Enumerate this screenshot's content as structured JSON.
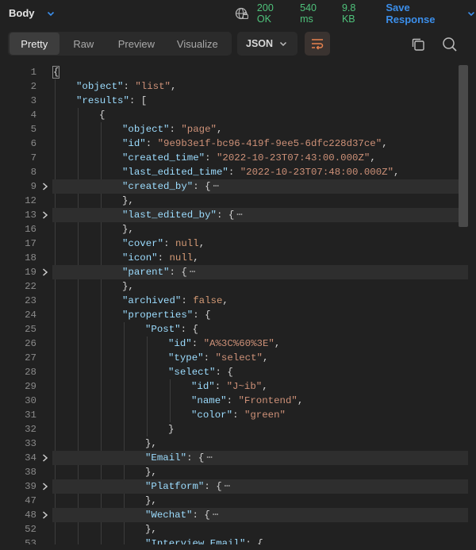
{
  "header": {
    "body_label": "Body",
    "status_code": "200 OK",
    "time": "540 ms",
    "size": "9.8 KB",
    "save_label": "Save Response"
  },
  "toolbar": {
    "tabs": [
      "Pretty",
      "Raw",
      "Preview",
      "Visualize"
    ],
    "active_tab": "Pretty",
    "format": "JSON",
    "icons": [
      "globe-icon",
      "chevron-down-icon",
      "wrap-lines-icon",
      "copy-icon",
      "search-icon"
    ]
  },
  "colors": {
    "key": "#9cdcfe",
    "string": "#ce9178",
    "keyword": "#d49a75",
    "status_green": "#4fc27b",
    "accent_blue": "#3b8eea",
    "wrap_icon": "#e8824e"
  },
  "code": {
    "lines": [
      {
        "n": "1",
        "indent": 0,
        "tokens": [
          [
            "p",
            "{"
          ]
        ],
        "box": true
      },
      {
        "n": "2",
        "indent": 1,
        "tokens": [
          [
            "k",
            "\"object\""
          ],
          [
            "p",
            ": "
          ],
          [
            "s",
            "\"list\""
          ],
          [
            "p",
            ","
          ]
        ]
      },
      {
        "n": "3",
        "indent": 1,
        "tokens": [
          [
            "k",
            "\"results\""
          ],
          [
            "p",
            ": ["
          ]
        ]
      },
      {
        "n": "4",
        "indent": 2,
        "tokens": [
          [
            "p",
            "{"
          ]
        ]
      },
      {
        "n": "5",
        "indent": 3,
        "tokens": [
          [
            "k",
            "\"object\""
          ],
          [
            "p",
            ": "
          ],
          [
            "s",
            "\"page\""
          ],
          [
            "p",
            ","
          ]
        ]
      },
      {
        "n": "6",
        "indent": 3,
        "tokens": [
          [
            "k",
            "\"id\""
          ],
          [
            "p",
            ": "
          ],
          [
            "s",
            "\"9e9b3e1f-bc96-419f-9ee5-6dfc228d37ce\""
          ],
          [
            "p",
            ","
          ]
        ]
      },
      {
        "n": "7",
        "indent": 3,
        "tokens": [
          [
            "k",
            "\"created_time\""
          ],
          [
            "p",
            ": "
          ],
          [
            "s",
            "\"2022-10-23T07:43:00.000Z\""
          ],
          [
            "p",
            ","
          ]
        ]
      },
      {
        "n": "8",
        "indent": 3,
        "tokens": [
          [
            "k",
            "\"last_edited_time\""
          ],
          [
            "p",
            ": "
          ],
          [
            "s",
            "\"2022-10-23T07:48:00.000Z\""
          ],
          [
            "p",
            ","
          ]
        ]
      },
      {
        "n": "9",
        "indent": 3,
        "tokens": [
          [
            "k",
            "\"created_by\""
          ],
          [
            "p",
            ": {"
          ],
          [
            "e",
            "⋯"
          ]
        ],
        "fold": true,
        "hl": true
      },
      {
        "n": "12",
        "indent": 3,
        "tokens": [
          [
            "p",
            "},"
          ]
        ]
      },
      {
        "n": "13",
        "indent": 3,
        "tokens": [
          [
            "k",
            "\"last_edited_by\""
          ],
          [
            "p",
            ": {"
          ],
          [
            "e",
            "⋯"
          ]
        ],
        "fold": true,
        "hl": true
      },
      {
        "n": "16",
        "indent": 3,
        "tokens": [
          [
            "p",
            "},"
          ]
        ]
      },
      {
        "n": "17",
        "indent": 3,
        "tokens": [
          [
            "k",
            "\"cover\""
          ],
          [
            "p",
            ": "
          ],
          [
            "w",
            "null"
          ],
          [
            "p",
            ","
          ]
        ]
      },
      {
        "n": "18",
        "indent": 3,
        "tokens": [
          [
            "k",
            "\"icon\""
          ],
          [
            "p",
            ": "
          ],
          [
            "w",
            "null"
          ],
          [
            "p",
            ","
          ]
        ]
      },
      {
        "n": "19",
        "indent": 3,
        "tokens": [
          [
            "k",
            "\"parent\""
          ],
          [
            "p",
            ": {"
          ],
          [
            "e",
            "⋯"
          ]
        ],
        "fold": true,
        "hl": true
      },
      {
        "n": "22",
        "indent": 3,
        "tokens": [
          [
            "p",
            "},"
          ]
        ]
      },
      {
        "n": "23",
        "indent": 3,
        "tokens": [
          [
            "k",
            "\"archived\""
          ],
          [
            "p",
            ": "
          ],
          [
            "w",
            "false"
          ],
          [
            "p",
            ","
          ]
        ]
      },
      {
        "n": "24",
        "indent": 3,
        "tokens": [
          [
            "k",
            "\"properties\""
          ],
          [
            "p",
            ": {"
          ]
        ]
      },
      {
        "n": "25",
        "indent": 4,
        "tokens": [
          [
            "k",
            "\"Post\""
          ],
          [
            "p",
            ": {"
          ]
        ]
      },
      {
        "n": "26",
        "indent": 5,
        "tokens": [
          [
            "k",
            "\"id\""
          ],
          [
            "p",
            ": "
          ],
          [
            "s",
            "\"A%3C%60%3E\""
          ],
          [
            "p",
            ","
          ]
        ]
      },
      {
        "n": "27",
        "indent": 5,
        "tokens": [
          [
            "k",
            "\"type\""
          ],
          [
            "p",
            ": "
          ],
          [
            "s",
            "\"select\""
          ],
          [
            "p",
            ","
          ]
        ]
      },
      {
        "n": "28",
        "indent": 5,
        "tokens": [
          [
            "k",
            "\"select\""
          ],
          [
            "p",
            ": {"
          ]
        ]
      },
      {
        "n": "29",
        "indent": 6,
        "tokens": [
          [
            "k",
            "\"id\""
          ],
          [
            "p",
            ": "
          ],
          [
            "s",
            "\"J~ib\""
          ],
          [
            "p",
            ","
          ]
        ]
      },
      {
        "n": "30",
        "indent": 6,
        "tokens": [
          [
            "k",
            "\"name\""
          ],
          [
            "p",
            ": "
          ],
          [
            "s",
            "\"Frontend\""
          ],
          [
            "p",
            ","
          ]
        ]
      },
      {
        "n": "31",
        "indent": 6,
        "tokens": [
          [
            "k",
            "\"color\""
          ],
          [
            "p",
            ": "
          ],
          [
            "s",
            "\"green\""
          ]
        ]
      },
      {
        "n": "32",
        "indent": 5,
        "tokens": [
          [
            "p",
            "}"
          ]
        ]
      },
      {
        "n": "33",
        "indent": 4,
        "tokens": [
          [
            "p",
            "},"
          ]
        ]
      },
      {
        "n": "34",
        "indent": 4,
        "tokens": [
          [
            "k",
            "\"Email\""
          ],
          [
            "p",
            ": {"
          ],
          [
            "e",
            "⋯"
          ]
        ],
        "fold": true,
        "hl": true
      },
      {
        "n": "38",
        "indent": 4,
        "tokens": [
          [
            "p",
            "},"
          ]
        ]
      },
      {
        "n": "39",
        "indent": 4,
        "tokens": [
          [
            "k",
            "\"Platform\""
          ],
          [
            "p",
            ": {"
          ],
          [
            "e",
            "⋯"
          ]
        ],
        "fold": true,
        "hl": true
      },
      {
        "n": "47",
        "indent": 4,
        "tokens": [
          [
            "p",
            "},"
          ]
        ]
      },
      {
        "n": "48",
        "indent": 4,
        "tokens": [
          [
            "k",
            "\"Wechat\""
          ],
          [
            "p",
            ": {"
          ],
          [
            "e",
            "⋯"
          ]
        ],
        "fold": true,
        "hl": true
      },
      {
        "n": "52",
        "indent": 4,
        "tokens": [
          [
            "p",
            "},"
          ]
        ]
      },
      {
        "n": "53",
        "indent": 4,
        "tokens": [
          [
            "k",
            "\"Interview Email\""
          ],
          [
            "p",
            ": {"
          ]
        ]
      }
    ]
  }
}
